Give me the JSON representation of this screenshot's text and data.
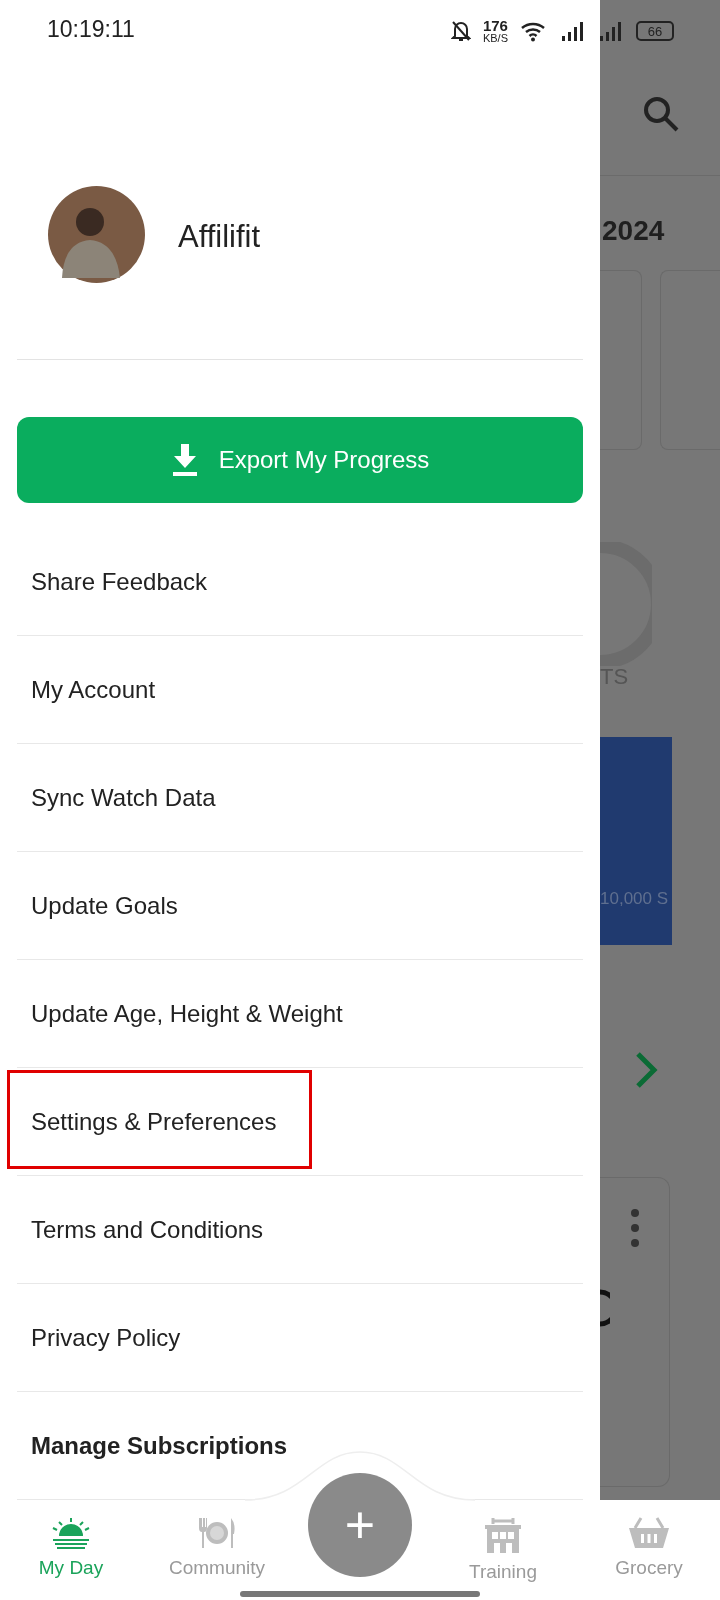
{
  "status_bar": {
    "time": "10:19:11",
    "net_speed": "176",
    "net_unit": "KB/S",
    "battery": "66"
  },
  "drawer": {
    "profile_name": "Affilifit",
    "export_button": "Export My Progress",
    "menu": [
      {
        "label": "Share Feedback",
        "bold": false,
        "highlighted": false
      },
      {
        "label": "My Account",
        "bold": false,
        "highlighted": false
      },
      {
        "label": "Sync Watch Data",
        "bold": false,
        "highlighted": false
      },
      {
        "label": "Update Goals",
        "bold": false,
        "highlighted": false
      },
      {
        "label": "Update Age, Height & Weight",
        "bold": false,
        "highlighted": false
      },
      {
        "label": "Settings & Preferences",
        "bold": false,
        "highlighted": true
      },
      {
        "label": "Terms and Conditions",
        "bold": false,
        "highlighted": false
      },
      {
        "label": "Privacy Policy",
        "bold": false,
        "highlighted": false
      },
      {
        "label": "Manage Subscriptions",
        "bold": true,
        "highlighted": false
      }
    ]
  },
  "background_page": {
    "date_fragment": "2024",
    "ring_label_fragment": "TS",
    "steps_fragment": "10,000 S"
  },
  "bottom_nav": [
    {
      "label": "My Day",
      "kind": "sun",
      "selected": true
    },
    {
      "label": "Community",
      "kind": "plate",
      "selected": false
    },
    {
      "label": "Training",
      "kind": "gym",
      "selected": false
    },
    {
      "label": "Grocery",
      "kind": "basket",
      "selected": false
    }
  ],
  "fab": "+"
}
